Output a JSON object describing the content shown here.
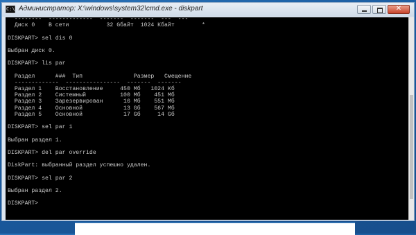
{
  "window": {
    "title": "Администратор: X:\\windows\\system32\\cmd.exe - diskpart",
    "icon_text": "C:\\",
    "minimize_icon": "minimize-icon",
    "maximize_icon": "maximize-icon",
    "close_icon": "close-icon"
  },
  "console": {
    "lines": [
      "  --------  -------------  -------  -------  ---  ---",
      "  Диск 0    В сети           32 Gбайт  1024 Кбайт        *",
      "",
      "DISKPART> sel dis 0",
      "",
      "Выбран диск 0.",
      "",
      "DISKPART> lis par",
      "",
      "  Раздел      ###  Тип               Размер   Смещение",
      "  -------------  ----------------  -------  -------",
      "  Раздел 1    Восстановление     450 Мб   1024 Кб",
      "  Раздел 2    Системный          100 Мб    451 Мб",
      "  Раздел 3    Зарезервирован      16 Мб    551 Мб",
      "  Раздел 4    Основной            13 Gб    567 Мб",
      "  Раздел 5    Основной            17 Gб     14 Gб",
      "",
      "DISKPART> sel par 1",
      "",
      "Выбран раздел 1.",
      "",
      "DISKPART> del par override",
      "",
      "DiskPart: выбранный раздел успешно удален.",
      "",
      "DISKPART> sel par 2",
      "",
      "Выбран раздел 2.",
      "",
      "DISKPART> ",
      ""
    ]
  },
  "colors": {
    "console_bg": "#000000",
    "console_text": "#c9c9c9",
    "desktop": "#1a5a9e",
    "close_button": "#c9452d"
  }
}
